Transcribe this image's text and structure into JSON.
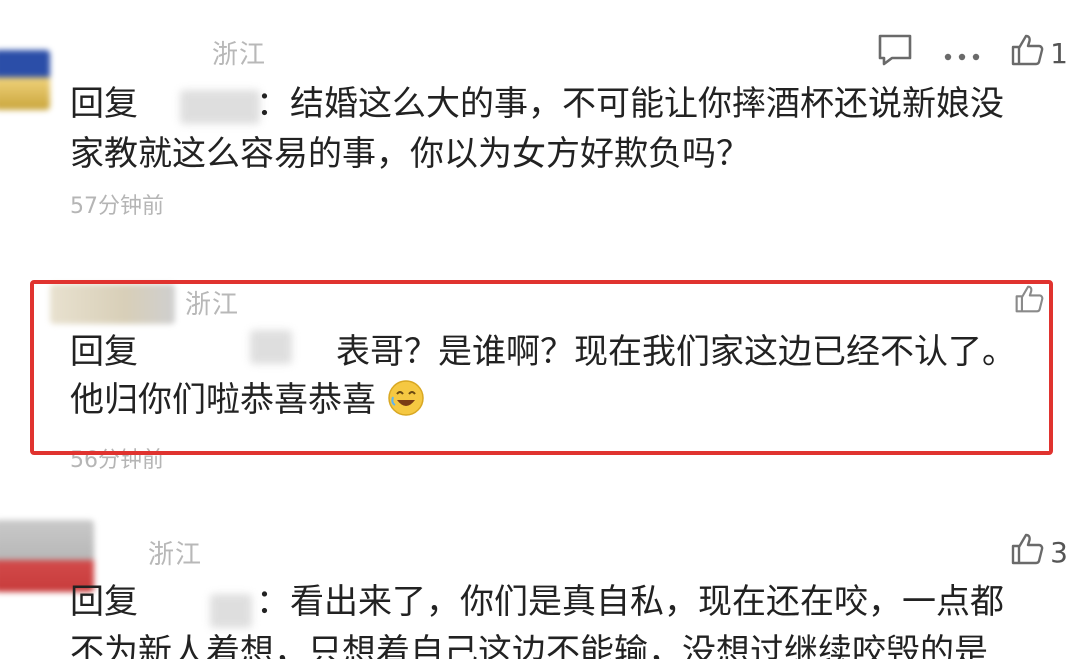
{
  "comments": [
    {
      "location": "浙江",
      "reply_prefix": "回复",
      "separator": "：",
      "text_line1": "结婚这么大的事，不可能让你摔酒杯还说新娘没",
      "text_line2": "家教就这么容易的事，你以为女方好欺负吗？",
      "time": "57分钟前",
      "likes": "1"
    },
    {
      "location": "浙江",
      "reply_prefix": "回复",
      "text_line1": "表哥？是谁啊？现在我们家这边已经不认了。",
      "text_line2": "他归你们啦恭喜恭喜",
      "emoji": "laughing-face-emoji",
      "time": "56分钟前",
      "highlighted": true
    },
    {
      "location": "浙江",
      "reply_prefix": "回复",
      "separator": "：",
      "text_line1": "看出来了，你们是真自私，现在还在咬，一点都",
      "text_line2": "不为新人着想，只想着自己这边不能输，没想过继续咬毁的是",
      "likes": "3"
    }
  ],
  "colors": {
    "highlight_border": "#e0332f",
    "meta_text": "#b8b8b8",
    "body_text": "#222222"
  },
  "icons": {
    "comment": "comment-bubble-icon",
    "more": "more-dots-icon",
    "like": "thumbs-up-icon"
  }
}
